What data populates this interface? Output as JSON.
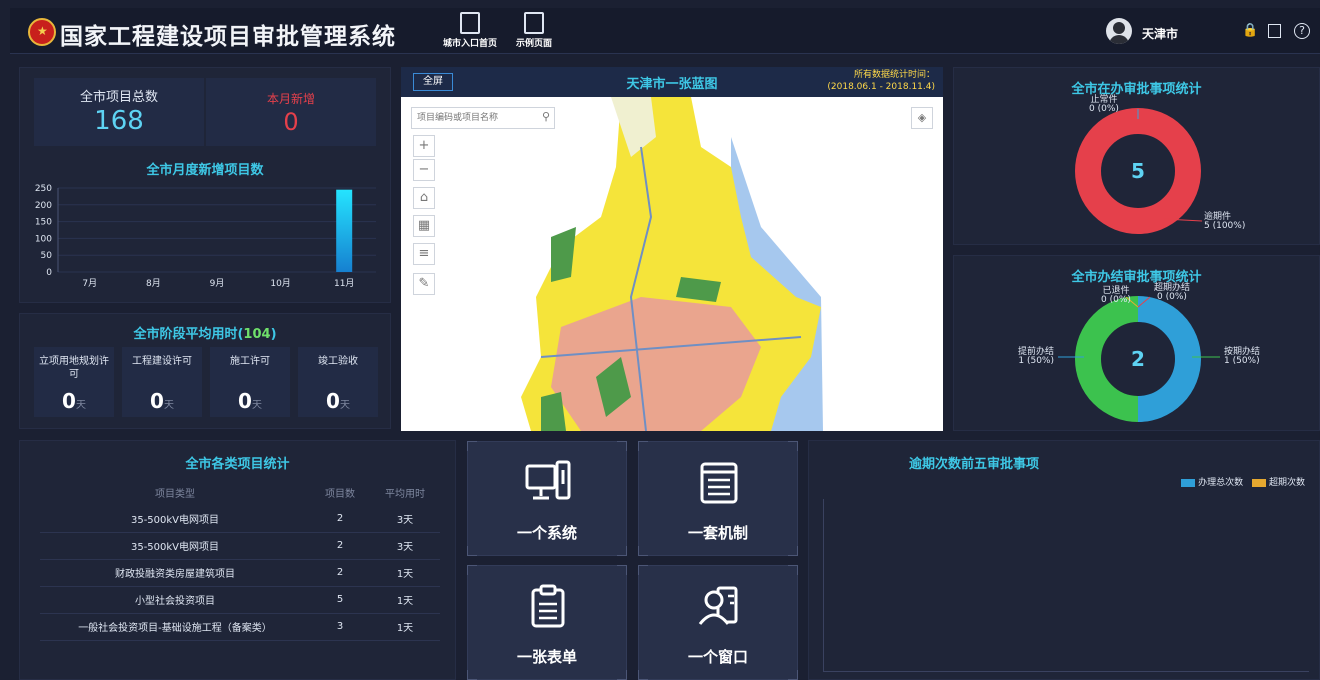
{
  "header": {
    "title": "国家工程建设项目审批管理系统",
    "nav": [
      "城市入口首页",
      "示例页面"
    ],
    "user": "天津市",
    "icons": [
      "lock-icon",
      "logout-icon",
      "help-icon"
    ]
  },
  "summary": {
    "total_label": "全市项目总数",
    "total_value": "168",
    "new_label": "本月新增",
    "new_value": "0"
  },
  "monthly": {
    "title": "全市月度新增项目数",
    "chart_data": {
      "type": "bar",
      "categories": [
        "7月",
        "8月",
        "9月",
        "10月",
        "11月"
      ],
      "values": [
        0,
        0,
        0,
        0,
        245
      ],
      "ylim": [
        0,
        250
      ],
      "yticks": [
        0,
        50,
        100,
        150,
        200,
        250
      ]
    }
  },
  "stages": {
    "title_prefix": "全市阶段平均用时(",
    "title_value": "104",
    "title_suffix": ")",
    "unit": "天",
    "items": [
      {
        "label": "立项用地规划许可",
        "value": "0"
      },
      {
        "label": "工程建设许可",
        "value": "0"
      },
      {
        "label": "施工许可",
        "value": "0"
      },
      {
        "label": "竣工验收",
        "value": "0"
      }
    ]
  },
  "map": {
    "fullscreen_label": "全屏",
    "title": "天津市一张蓝图",
    "stat_time_label": "所有数据统计时间：",
    "stat_time_range": "(2018.06.1 - 2018.11.4)",
    "search_placeholder": "项目编码或项目名称",
    "colors": {
      "yellow": "#f5e43a",
      "salmon": "#eaa58e",
      "green": "#4e9a4a",
      "sea": "#a6c8ee"
    }
  },
  "in_progress": {
    "title": "全市在办审批事项统计",
    "center_value": "5",
    "chart_data": {
      "type": "pie",
      "labels": [
        "止常件",
        "逾期件"
      ],
      "values": [
        0,
        5
      ],
      "percent_labels": [
        "0 (0%)",
        "5 (100%)"
      ]
    },
    "colors": [
      "#3aa0d8",
      "#e5404b"
    ]
  },
  "completed": {
    "title": "全市办结审批事项统计",
    "center_value": "2",
    "chart_data": {
      "type": "pie",
      "labels": [
        "提前办结",
        "按期办结",
        "已退件",
        "超期办结"
      ],
      "values": [
        1,
        1,
        0,
        0
      ],
      "percent_labels": [
        "1 (50%)",
        "1 (50%)",
        "0 (0%)",
        "0 (0%)"
      ]
    },
    "colors": [
      "#2f9fd8",
      "#3cc24e",
      "#e5b030",
      "#e5404b"
    ]
  },
  "project_stats": {
    "title": "全市各类项目统计",
    "columns": [
      "项目类型",
      "项目数",
      "平均用时"
    ],
    "rows": [
      [
        "35-500kV电网项目",
        "2",
        "3天"
      ],
      [
        "35-500kV电网项目",
        "2",
        "3天"
      ],
      [
        "财政投融资类房屋建筑项目",
        "2",
        "1天"
      ],
      [
        "小型社会投资项目",
        "5",
        "1天"
      ],
      [
        "一般社会投资项目-基础设施工程（备案类）",
        "3",
        "1天"
      ]
    ]
  },
  "cards": [
    {
      "label": "一个系统",
      "icon": "computer-icon"
    },
    {
      "label": "一套机制",
      "icon": "document-list-icon"
    },
    {
      "label": "一张表单",
      "icon": "clipboard-icon"
    },
    {
      "label": "一个窗口",
      "icon": "contact-card-icon"
    }
  ],
  "top5": {
    "title": "逾期次数前五审批事项",
    "legend": [
      "办理总次数",
      "超期次数"
    ],
    "colors": [
      "#2f9fd8",
      "#e5a830"
    ],
    "chart_data": {
      "type": "bar",
      "categories": [],
      "series": [
        {
          "name": "办理总次数",
          "values": []
        },
        {
          "name": "超期次数",
          "values": []
        }
      ]
    }
  }
}
